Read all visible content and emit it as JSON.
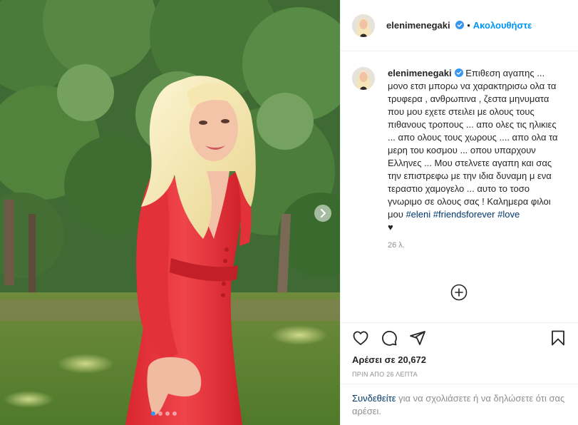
{
  "post": {
    "username": "elenimenegaki",
    "follow_label": "Ακολουθήστε",
    "separator": "•",
    "caption": {
      "body": "Επιθεση αγαπης ... μονο ετσι μπορω να χαρακτηρισω ολα τα τρυφερα , ανθρωπινα , ζεστα μηνυματα που μου εχετε στειλει με ολους τους πιθανους τροπους ... απο ολες τις ηλικιες ... απο ολους τους χωρους .... απο ολα τα μερη του κοσμου ... οπου υπαρχουν Ελληνες ... Μου στελνετε αγαπη και σας την επιστρεφω με την ιδια δυναμη μ ενα τεραστιο χαμογελο ... αυτο το τοσο γνωριμο σε ολους σας ! Καλημερα φιλοι μου ",
      "hashtags": [
        "#eleni",
        "#friendsforever",
        "#love"
      ],
      "emoji": "♥"
    },
    "caption_time": "26 λ.",
    "likes_label": "Αρέσει σε 20,672",
    "timestamp": "ΠΡΙΝ ΑΠΟ 26 ΛΕΠΤΑ",
    "login_prompt": {
      "link": "Συνδεθείτε",
      "rest": " για να σχολιάσετε ή να δηλώσετε ότι σας αρέσει."
    },
    "carousel": {
      "count": 4,
      "active_index": 0
    }
  },
  "icons": {
    "verified": "verified-badge-icon",
    "like": "heart-icon",
    "comment": "comment-icon",
    "share": "share-icon",
    "save": "bookmark-icon",
    "next": "chevron-right-icon",
    "load_more": "plus-circle-icon"
  },
  "colors": {
    "accent": "#0095f6",
    "hashtag": "#00376b",
    "verified": "#3897f0",
    "muted": "#8e8e8e",
    "dress": "#e8323c"
  }
}
